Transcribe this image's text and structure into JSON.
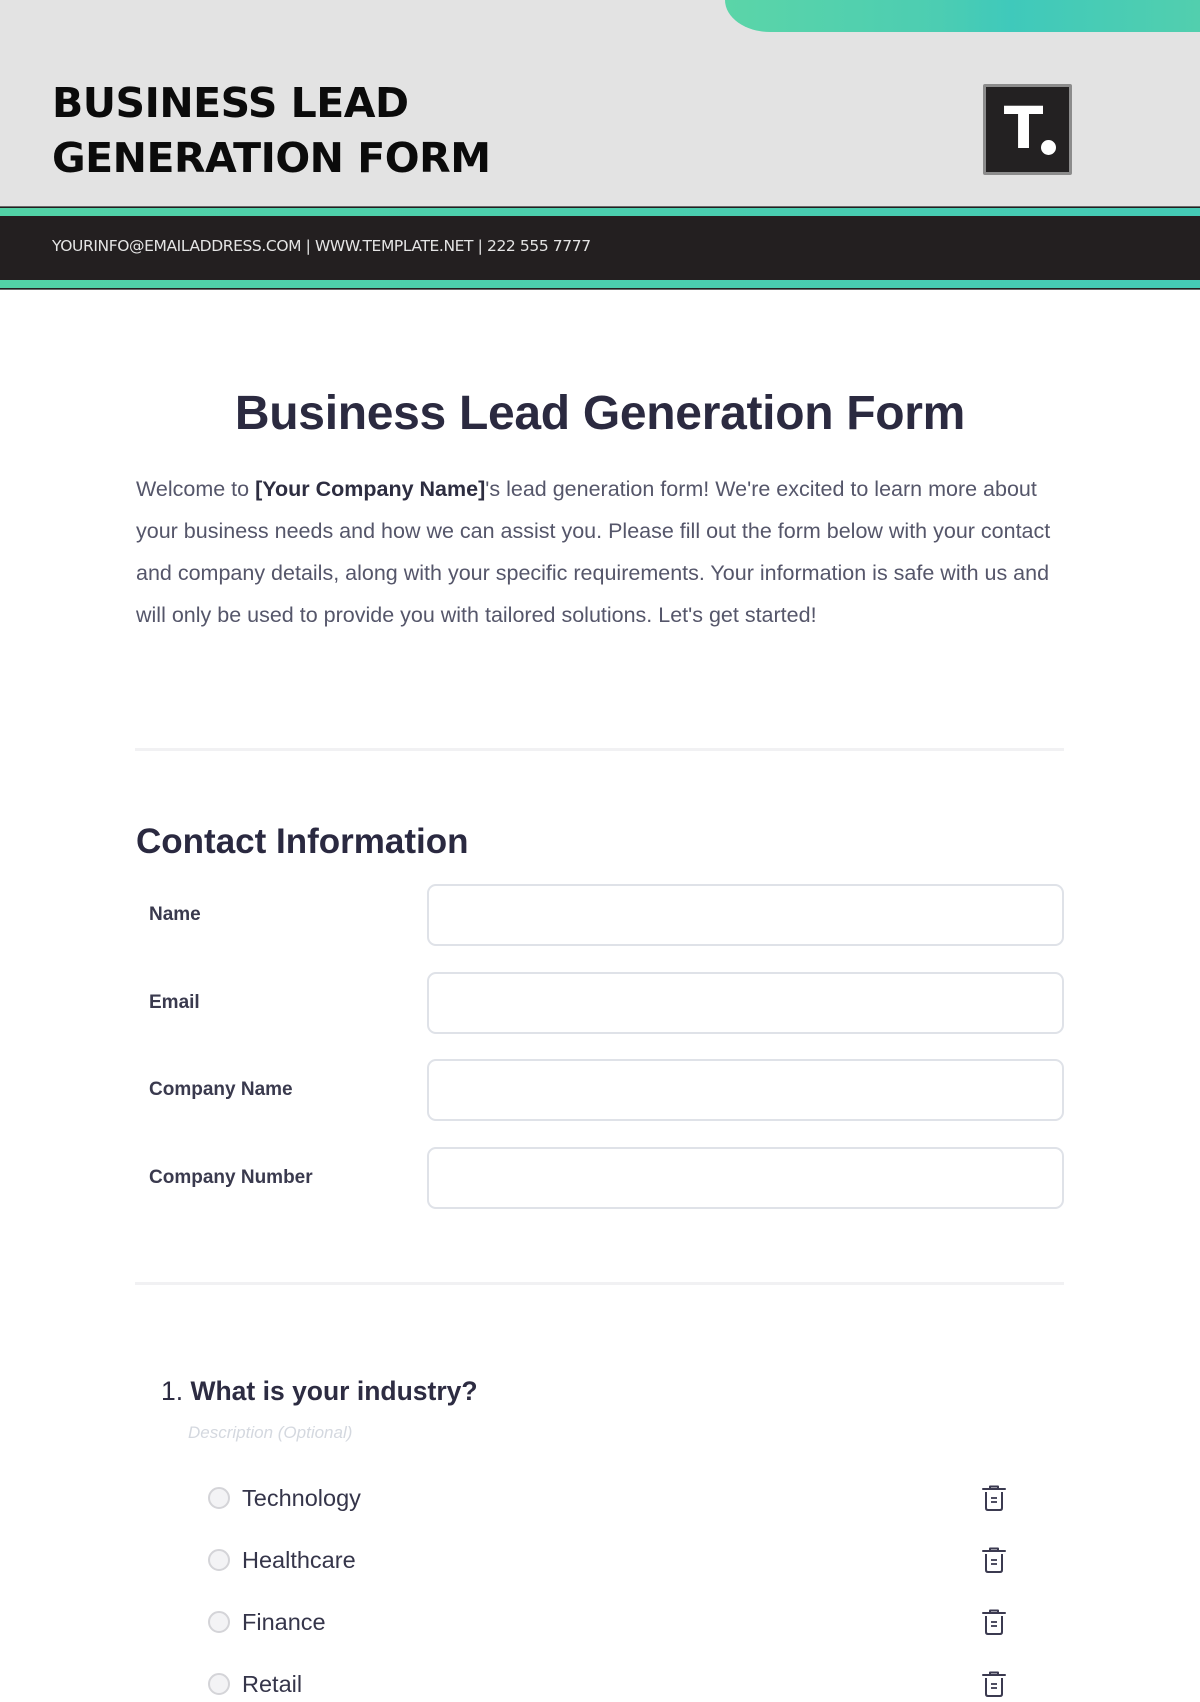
{
  "header": {
    "title_lines": [
      "BUSINESS LEAD",
      "GENERATION FORM"
    ],
    "logo_letter": "T",
    "logo_icon": "template-logo-icon",
    "contact_line": "YOURINFO@EMAILADDRESS.COM | WWW.TEMPLATE.NET | 222 555 7777",
    "accent_color": "#44cab5",
    "band_color": "#231f20"
  },
  "intro": {
    "title": "Business Lead Generation Form",
    "text_before": "Welcome to ",
    "company_placeholder": "[Your Company Name]",
    "text_after": "'s lead generation form! We're excited to learn more about your business needs and how we can assist you. Please fill out the form below with your contact and company details, along with your specific requirements. Your information is safe with us and will only be used to provide you with tailored solutions. Let's get started!"
  },
  "contact_section": {
    "title": "Contact Information",
    "fields": [
      {
        "label": "Name",
        "value": "",
        "placeholder": ""
      },
      {
        "label": "Email",
        "value": "",
        "placeholder": ""
      },
      {
        "label": "Company Name",
        "value": "",
        "placeholder": ""
      },
      {
        "label": "Company Number",
        "value": "",
        "placeholder": ""
      }
    ]
  },
  "questions": [
    {
      "number": "1.",
      "text": "What is your industry?",
      "description_placeholder": "Description (Optional)",
      "options": [
        {
          "label": "Technology",
          "selected": false,
          "delete_icon": "trash-icon"
        },
        {
          "label": "Healthcare",
          "selected": false,
          "delete_icon": "trash-icon"
        },
        {
          "label": "Finance",
          "selected": false,
          "delete_icon": "trash-icon"
        },
        {
          "label": "Retail",
          "selected": false,
          "delete_icon": "trash-icon"
        }
      ]
    }
  ]
}
